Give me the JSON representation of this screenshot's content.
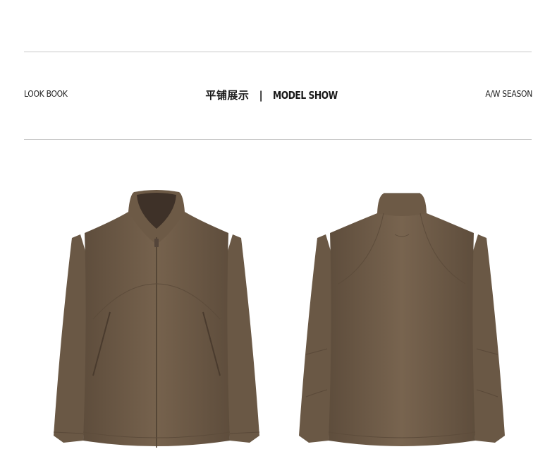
{
  "header": {
    "left_label": "LOOK BOOK",
    "title_cn": "平铺展示",
    "separator": "|",
    "title_en": "MODEL SHOW",
    "right_label": "A/W SEASON"
  },
  "colors": {
    "jacket": "#6f5c48",
    "jacket_shadow": "#5b4a39",
    "jacket_highlight": "#80705c",
    "collar_inner": "#3e3128",
    "rule": "#c8c8c8"
  },
  "images": {
    "front": "jacket-front-image",
    "back": "jacket-back-image"
  }
}
